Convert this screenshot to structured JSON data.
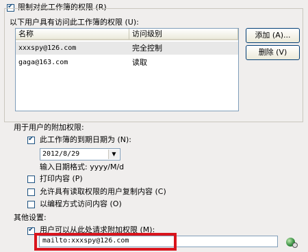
{
  "restrict": {
    "checked": true,
    "label": "限制对此工作簿的权限 (R)"
  },
  "users_section": {
    "title": "以下用户具有访问此工作簿的权限 (U):",
    "columns": [
      "名称",
      "访问级别"
    ],
    "rows": [
      {
        "name": "xxxspy@126.com",
        "level": "完全控制"
      },
      {
        "name": "gaga@163.com",
        "level": "读取"
      }
    ],
    "add_button": "添加 (A)...",
    "delete_button": "删除 (V)"
  },
  "additional_permissions": {
    "title": "用于用户的附加权限:",
    "expiry": {
      "checked": true,
      "label": "此工作簿的到期日期为 (N):",
      "date": "2012/8/29",
      "format_hint": "输入日期格式: yyyy/M/d"
    },
    "print": {
      "checked": false,
      "label": "打印内容 (P)"
    },
    "copy": {
      "checked": false,
      "label": "允许具有读取权限的用户复制内容 (C)"
    },
    "programmatic": {
      "checked": false,
      "label": "以编程方式访问内容 (O)"
    }
  },
  "other_settings": {
    "title": "其他设置:",
    "request": {
      "checked": true,
      "label": "用户可以从此处请求附加权限 (M):",
      "value": "mailto:xxxspy@126.com"
    }
  },
  "icons": {
    "dropdown": "chevron-down-icon",
    "contact": "globe-link-icon"
  },
  "colors": {
    "highlight_box": "#d9141c",
    "checkbox_border": "#1c5180"
  }
}
